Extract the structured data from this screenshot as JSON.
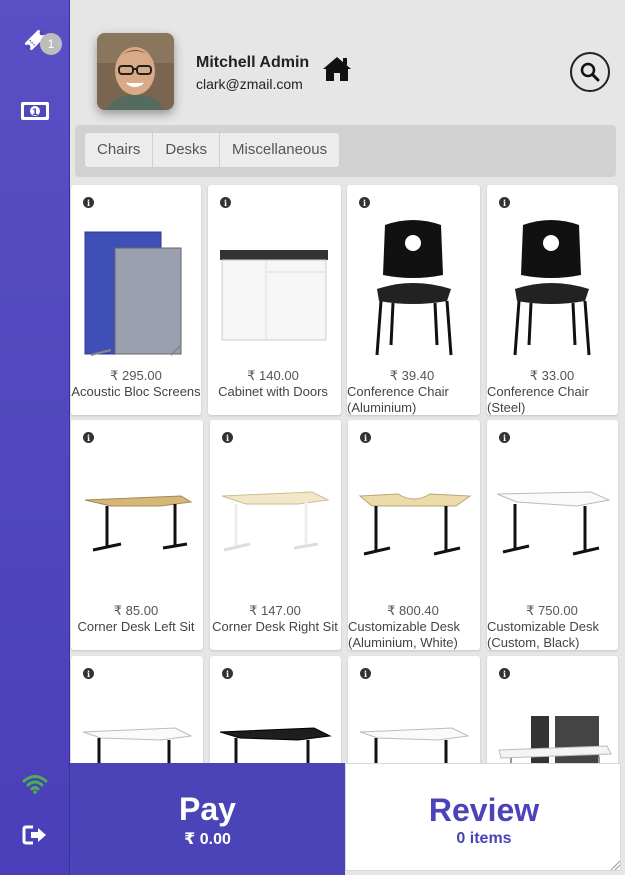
{
  "rail": {
    "tickets_badge": "1",
    "icons": [
      "ticket-icon",
      "cash-icon",
      "wifi-icon",
      "sign-out-icon"
    ]
  },
  "header": {
    "user_name": "Mitchell Admin",
    "user_email": "clark@zmail.com"
  },
  "categories": [
    "Chairs",
    "Desks",
    "Miscellaneous"
  ],
  "products": [
    {
      "price": "₹ 295.00",
      "name": "Acoustic Bloc Screens"
    },
    {
      "price": "₹ 140.00",
      "name": "Cabinet with Doors"
    },
    {
      "price": "₹ 39.40",
      "name": "Conference Chair (Aluminium)"
    },
    {
      "price": "₹ 33.00",
      "name": "Conference Chair (Steel)"
    },
    {
      "price": "₹ 85.00",
      "name": "Corner Desk Left Sit"
    },
    {
      "price": "₹ 147.00",
      "name": "Corner Desk Right Sit"
    },
    {
      "price": "₹ 800.40",
      "name": "Customizable Desk (Aluminium, White)"
    },
    {
      "price": "₹ 750.00",
      "name": "Customizable Desk (Custom, Black)"
    },
    {
      "price": "",
      "name": ""
    },
    {
      "price": "",
      "name": ""
    },
    {
      "price": "",
      "name": ""
    },
    {
      "price": "",
      "name": ""
    }
  ],
  "actions": {
    "pay_label": "Pay",
    "pay_amount": "₹ 0.00",
    "review_label": "Review",
    "review_count": "0 items"
  },
  "colors": {
    "primary": "#4b43b8",
    "rail": "#5046be",
    "background": "#e6e6e6",
    "wifi": "#4caf50"
  }
}
